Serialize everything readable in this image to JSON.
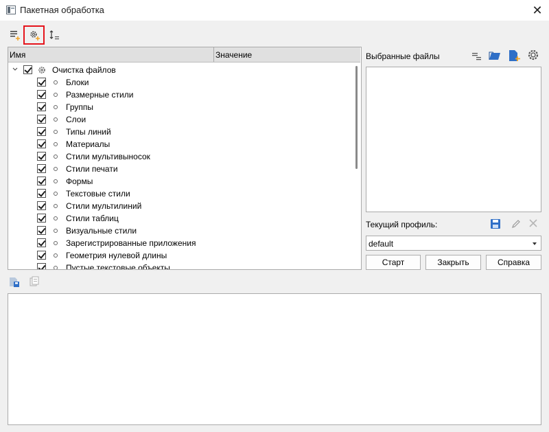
{
  "window": {
    "title": "Пакетная обработка",
    "close_icon": "close-icon"
  },
  "toolbar": {
    "icons": [
      "list-add-icon",
      "gear-add-icon",
      "sort-icon"
    ],
    "selected_index": 1,
    "selected_color": "#e5131b"
  },
  "tree": {
    "columns": [
      "Имя",
      "Значение"
    ],
    "root": {
      "label": "Очистка файлов",
      "checked": true,
      "expanded": true,
      "icon": "gear-icon"
    },
    "items": [
      {
        "label": "Блоки",
        "checked": true
      },
      {
        "label": "Размерные стили",
        "checked": true
      },
      {
        "label": "Группы",
        "checked": true
      },
      {
        "label": "Слои",
        "checked": true
      },
      {
        "label": "Типы линий",
        "checked": true
      },
      {
        "label": "Материалы",
        "checked": true
      },
      {
        "label": "Стили мультивыносок",
        "checked": true
      },
      {
        "label": "Стили печати",
        "checked": true
      },
      {
        "label": "Формы",
        "checked": true
      },
      {
        "label": "Текстовые стили",
        "checked": true
      },
      {
        "label": "Стили мультилиний",
        "checked": true
      },
      {
        "label": "Стили таблиц",
        "checked": true
      },
      {
        "label": "Визуальные стили",
        "checked": true
      },
      {
        "label": "Зарегистрированные приложения",
        "checked": true
      },
      {
        "label": "Геометрия нулевой длины",
        "checked": true
      },
      {
        "label": "Пустые текстовые объекты",
        "checked": true
      }
    ]
  },
  "files_panel": {
    "label": "Выбранные файлы",
    "icons": [
      "list-icon",
      "open-folder-icon",
      "add-file-icon",
      "settings-icon"
    ]
  },
  "profile": {
    "label": "Текущий профиль:",
    "icons": [
      "save-icon",
      "edit-icon",
      "delete-icon"
    ],
    "value": "default"
  },
  "buttons": {
    "start": "Старт",
    "close": "Закрыть",
    "help": "Справка"
  },
  "log_toolbar": {
    "icons": [
      "save-log-icon",
      "copy-log-icon"
    ]
  },
  "colors": {
    "accent_blue": "#2f6fc7",
    "accent_orange": "#f2a52a",
    "background": "#f0f0f0"
  }
}
